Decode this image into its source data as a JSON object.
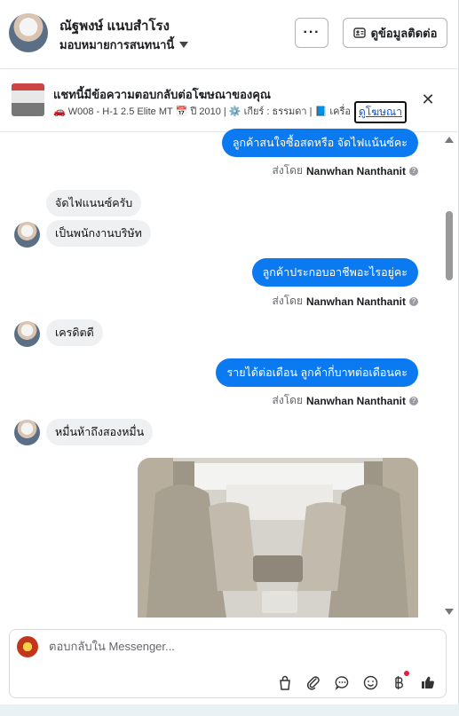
{
  "header": {
    "contact_name": "ณัฐพงษ์ แนบสำโรง",
    "assignee_label": "มอบหมายการสนทนานี้",
    "more_label": "···",
    "contact_info_label": "ดูข้อมูลติดต่อ"
  },
  "ad": {
    "title": "แชทนี้มีข้อความตอบกลับต่อโฆษณาของคุณ",
    "meta": "🚗 W008 - H-1 2.5 Elite MT 📅 ปี 2010 | ⚙️ เกียร์ : ธรรมดา | 📘 เครื่อง...",
    "link_label": "ดูโฆษณา",
    "close_label": "✕"
  },
  "messages": {
    "m1": "ลูกค้าสนใจซื้อสดหรือ จัดไฟแน้นซ์คะ",
    "m2": "จัดไฟแนนซ์ครับ",
    "m3": "เป็นพนักงานบริษัท",
    "m4": "ลูกค้าประกอบอาชีพอะไรอยู่คะ",
    "m5": "เครดิตดี",
    "m6": "รายได้ต่อเดือน  ลูกค้ากี่บาทต่อเดือนคะ",
    "m7": "หมื่นห้าถึงสองหมื่น"
  },
  "sent_by": {
    "prefix": "ส่งโดย",
    "name": "Nanwhan Nanthanit"
  },
  "composer": {
    "placeholder": "ตอบกลับใน Messenger..."
  },
  "colors": {
    "outgoing": "#0b79f0",
    "incoming": "#eef0f2",
    "notification": "#e41e3f"
  }
}
